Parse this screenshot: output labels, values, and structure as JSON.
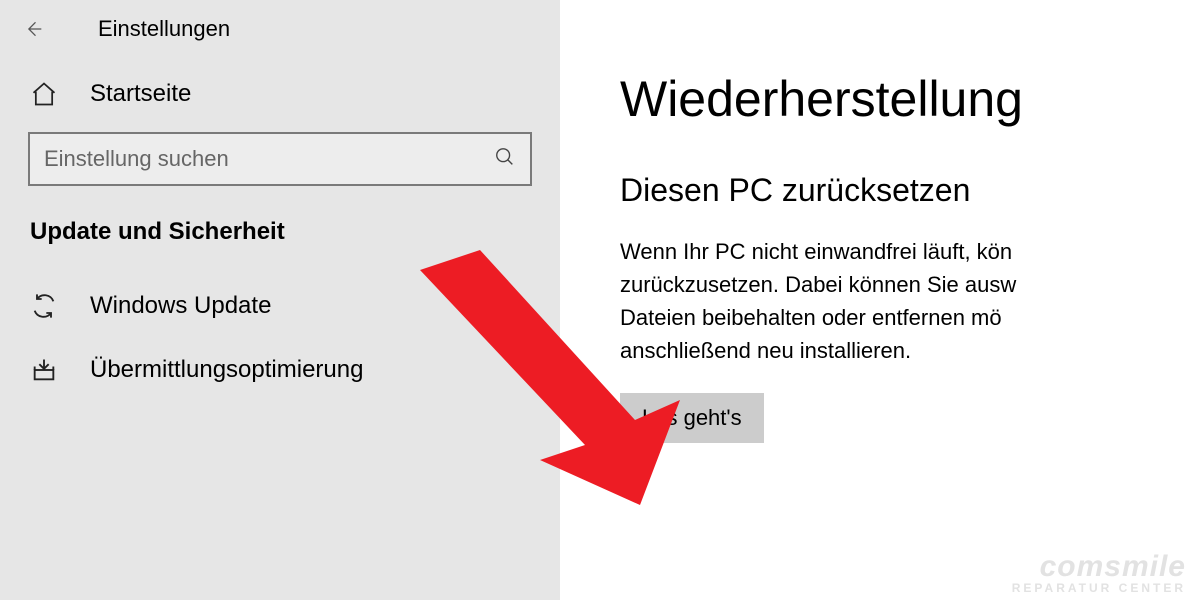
{
  "titlebar": {
    "title": "Einstellungen"
  },
  "sidebar": {
    "home_label": "Startseite",
    "search_placeholder": "Einstellung suchen",
    "section_label": "Update und Sicherheit",
    "items": [
      {
        "label": "Windows Update"
      },
      {
        "label": "Übermittlungsoptimierung"
      }
    ]
  },
  "main": {
    "page_title": "Wiederherstellung",
    "subsection_title": "Diesen PC zurücksetzen",
    "body_text": "Wenn Ihr PC nicht einwandfrei läuft, kön\nzurückzusetzen. Dabei können Sie ausw\nDateien beibehalten oder entfernen mö\nanschließend neu installieren.",
    "action_button": "Los geht's"
  },
  "watermark": {
    "line1": "comsmile",
    "line2": "REPARATUR CENTER"
  }
}
